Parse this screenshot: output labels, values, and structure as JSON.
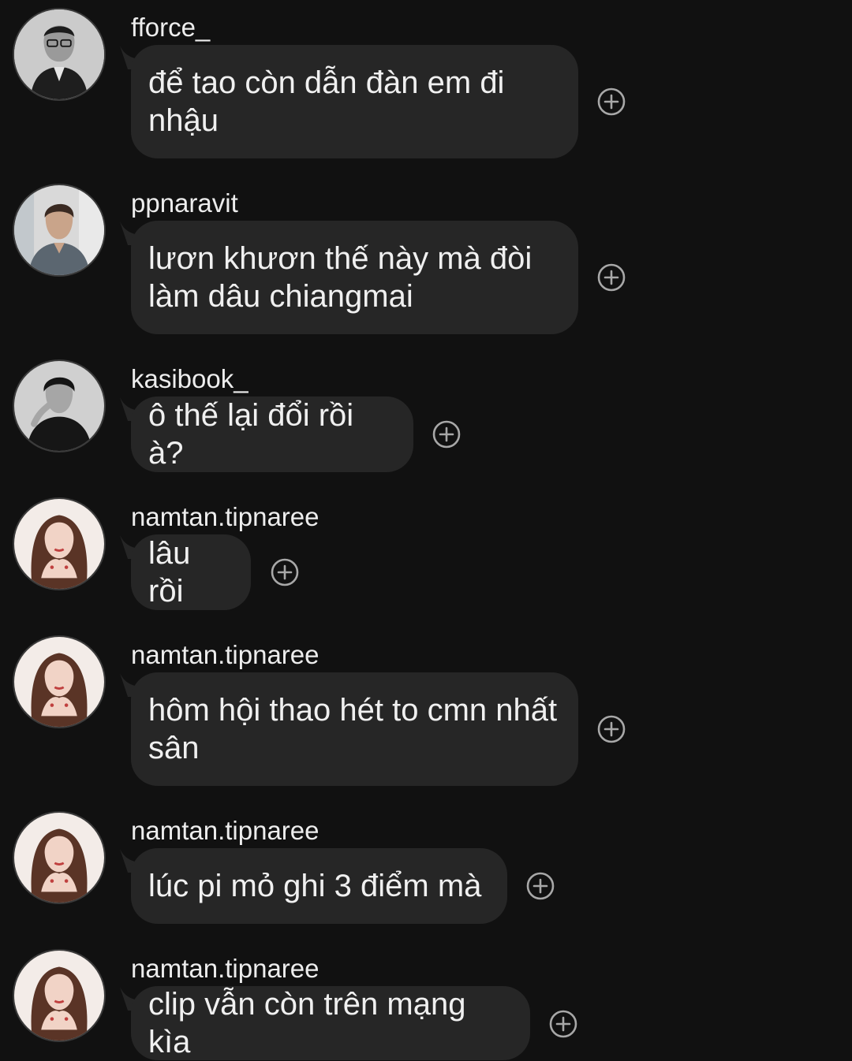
{
  "messages": [
    {
      "username": "fforce_",
      "text": "để tao còn dẫn đàn em đi nhậu",
      "avatar_icon": "male-avatar-glasses-icon"
    },
    {
      "username": "ppnaravit",
      "text": "lươn khươn thế này mà đòi làm dâu chiangmai",
      "avatar_icon": "male-avatar-icon"
    },
    {
      "username": "kasibook_",
      "text": "ô thế lại đổi rồi à?",
      "avatar_icon": "male-avatar-dark-icon"
    },
    {
      "username": "namtan.tipnaree",
      "text": "lâu rồi",
      "avatar_icon": "female-avatar-icon"
    },
    {
      "username": "namtan.tipnaree",
      "text": "hôm hội thao hét to cmn nhất sân",
      "avatar_icon": "female-avatar-icon"
    },
    {
      "username": "namtan.tipnaree",
      "text": "lúc pi mỏ ghi 3 điểm mà",
      "avatar_icon": "female-avatar-icon"
    },
    {
      "username": "namtan.tipnaree",
      "text": "clip vẫn còn trên mạng kìa",
      "avatar_icon": "female-avatar-icon"
    }
  ],
  "colors": {
    "background": "#111111",
    "bubble": "#262626",
    "text": "#f0f0f0",
    "react_icon": "#a8a8a8"
  }
}
